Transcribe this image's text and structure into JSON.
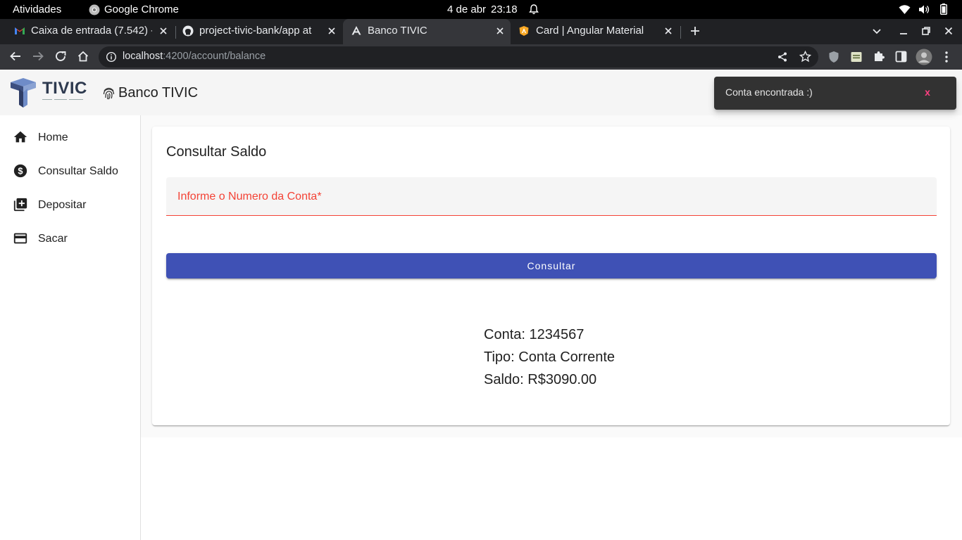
{
  "os": {
    "activities": "Atividades",
    "app_name": "Google Chrome",
    "date": "4 de abr",
    "time": "23:18"
  },
  "browser": {
    "tabs": [
      {
        "title": "Caixa de entrada (7.542) -",
        "favicon": "gmail-icon"
      },
      {
        "title": "project-tivic-bank/app at",
        "favicon": "github-icon"
      },
      {
        "title": "Banco TIVIC",
        "favicon": "angular-icon",
        "active": true
      },
      {
        "title": "Card | Angular Material",
        "favicon": "angular-material-icon"
      }
    ],
    "url_host": "localhost",
    "url_path": ":4200/account/balance"
  },
  "app": {
    "logo_text": "TIVIC",
    "title": "Banco TIVIC",
    "nav": [
      {
        "label": "Home",
        "icon": "home-icon"
      },
      {
        "label": "Consultar Saldo",
        "icon": "dollar-circle-icon"
      },
      {
        "label": "Depositar",
        "icon": "library-add-icon"
      },
      {
        "label": "Sacar",
        "icon": "credit-card-icon"
      }
    ],
    "card": {
      "title": "Consultar Saldo",
      "input_label": "Informe o Numero da Conta*",
      "input_value": "",
      "button_label": "Consultar",
      "result": {
        "account": "Conta: 1234567",
        "type": "Tipo: Conta Corrente",
        "balance": "Saldo: R$3090.00"
      }
    },
    "snackbar": {
      "message": "Conta encontrada :)",
      "action": "x"
    }
  },
  "colors": {
    "primary": "#3f51b5",
    "error": "#f44336",
    "snackbar_bg": "#323232",
    "snackbar_action": "#ff4081"
  }
}
